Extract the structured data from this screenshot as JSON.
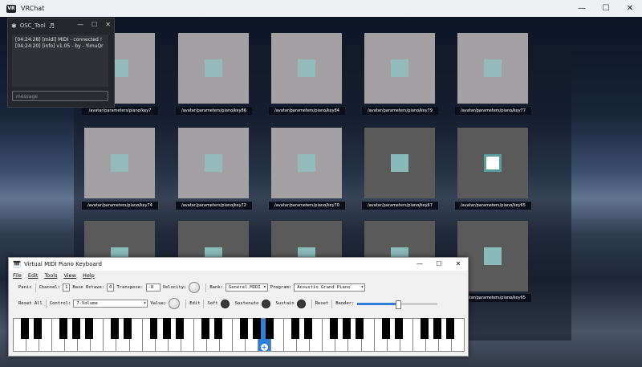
{
  "vrchat": {
    "title": "VRChat",
    "logo": "VR",
    "controls": {
      "minimize": "—",
      "maximize": "☐",
      "close": "✕"
    },
    "tile_colors": {
      "light": "#a3a1a3",
      "dark": "#5a5a5a",
      "inner_teal": "#8fc3c4",
      "inner_active_border": "#5a9ea2",
      "inner_active_fill": "#ffffff"
    },
    "tiles": [
      {
        "label": "/avatar/parameters/piano/key7",
        "shade": "light",
        "state": "idle"
      },
      {
        "label": "/avatar/parameters/piano/key86",
        "shade": "light",
        "state": "idle"
      },
      {
        "label": "/avatar/parameters/piano/key84",
        "shade": "light",
        "state": "idle"
      },
      {
        "label": "/avatar/parameters/piano/key79",
        "shade": "light",
        "state": "idle"
      },
      {
        "label": "/avatar/parameters/piano/key77",
        "shade": "light",
        "state": "idle"
      },
      {
        "label": "/avatar/parameters/piano/key74",
        "shade": "light",
        "state": "idle"
      },
      {
        "label": "/avatar/parameters/piano/key72",
        "shade": "light",
        "state": "idle"
      },
      {
        "label": "/avatar/parameters/piano/key70",
        "shade": "light",
        "state": "idle"
      },
      {
        "label": "/avatar/parameters/piano/key67",
        "shade": "dark",
        "state": "idle"
      },
      {
        "label": "/avatar/parameters/piano/key65",
        "shade": "dark",
        "state": "active"
      },
      {
        "label": "",
        "shade": "dark",
        "state": "idle"
      },
      {
        "label": "",
        "shade": "dark",
        "state": "idle"
      },
      {
        "label": "",
        "shade": "dark",
        "state": "idle"
      },
      {
        "label": "",
        "shade": "dark",
        "state": "idle"
      },
      {
        "label": "/avatar/parameters/piano/key65",
        "shade": "dark",
        "state": "idle"
      }
    ]
  },
  "osc_tool": {
    "title": "OSC_Tool",
    "controls": {
      "minimize": "—",
      "maximize": "☐",
      "close": "✕"
    },
    "log": [
      "[04:24:28] [midi] MIDI - connected !",
      "[04:24:20] [info] v1.05 - by - YimuQr"
    ],
    "message_placeholder": "message"
  },
  "vmpk": {
    "title": "Virtual MIDI Piano Keyboard",
    "controls": {
      "minimize": "—",
      "maximize": "☐",
      "close": "✕"
    },
    "menu": [
      "File",
      "Edit",
      "Tools",
      "View",
      "Help"
    ],
    "toolbar1": {
      "panic": "Panic",
      "channel_label": "Channel:",
      "channel_value": "1",
      "base_octave_label": "Base Octave:",
      "base_octave_value": "0",
      "transpose_label": "Transpose:",
      "transpose_value": "-8",
      "velocity_label": "Velocity:",
      "bank_label": "Bank:",
      "bank_value": "General MIDI",
      "program_label": "Program:",
      "program_value": "Acoustic Grand Piano"
    },
    "toolbar2": {
      "reset_all": "Reset All",
      "control_label": "Control:",
      "control_value": "7-Volume",
      "value_label": "Value:",
      "edit": "Edit",
      "soft": "Soft",
      "sostenuto": "Sostenuto",
      "sustain": "Sustain",
      "reset": "Reset",
      "bender_label": "Bender:",
      "bender_level": 0.5
    },
    "keyboard": {
      "white_keys": 35,
      "pressed_white_index": 19,
      "accent": "#2f7fd8"
    }
  }
}
